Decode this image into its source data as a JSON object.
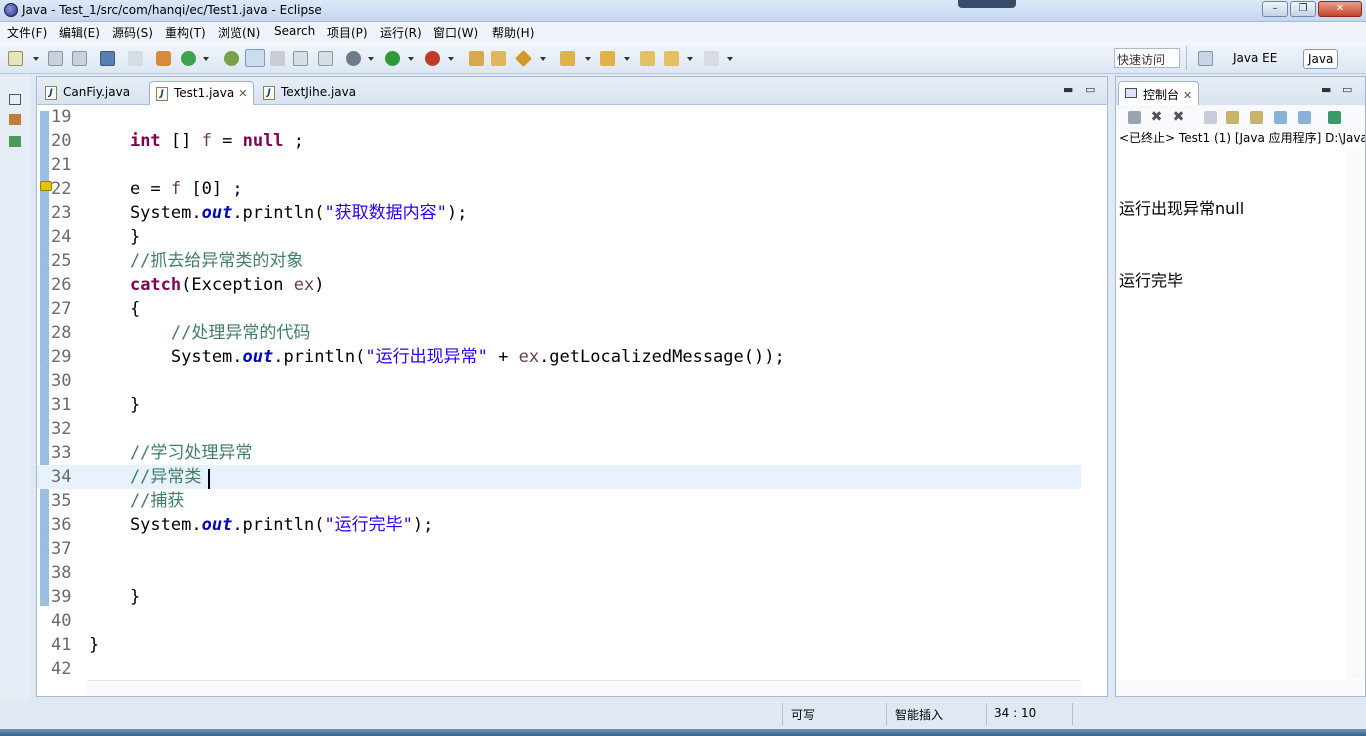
{
  "window": {
    "title": "Java - Test_1/src/com/hanqi/ec/Test1.java - Eclipse",
    "min": "–",
    "max": "❐",
    "close": "✕"
  },
  "menu": [
    "文件(F)",
    "编辑(E)",
    "源码(S)",
    "重构(T)",
    "浏览(N)",
    "Search",
    "项目(P)",
    "运行(R)",
    "窗口(W)",
    "帮助(H)"
  ],
  "toolbar": {
    "quick_access": "快速访问",
    "perspectives": [
      "Java EE",
      "Java"
    ]
  },
  "editor": {
    "tabs": [
      {
        "label": "CanFiy.java",
        "active": false
      },
      {
        "label": "Test1.java",
        "active": true
      },
      {
        "label": "TextJihe.java",
        "active": false
      }
    ],
    "lines": [
      {
        "n": "19",
        "t": []
      },
      {
        "n": "20",
        "t": [
          [
            "",
            "    "
          ],
          [
            "kw",
            "int"
          ],
          [
            "",
            " [] "
          ],
          [
            "var",
            "f"
          ],
          [
            "",
            " = "
          ],
          [
            "kw",
            "null"
          ],
          [
            "",
            " ;"
          ]
        ]
      },
      {
        "n": "21",
        "t": []
      },
      {
        "n": "22",
        "t": [
          [
            "",
            "    e = "
          ],
          [
            "var",
            "f"
          ],
          [
            "",
            " [0] ;"
          ]
        ]
      },
      {
        "n": "23",
        "t": [
          [
            "",
            "    System."
          ],
          [
            "fld",
            "out"
          ],
          [
            "",
            ".println("
          ],
          [
            "str",
            "\"获取数据内容\""
          ],
          [
            "",
            ");"
          ]
        ]
      },
      {
        "n": "24",
        "t": [
          [
            "",
            "    }"
          ]
        ]
      },
      {
        "n": "25",
        "t": [
          [
            "cmt",
            "    //抓去给异常类的对象"
          ]
        ]
      },
      {
        "n": "26",
        "t": [
          [
            "",
            "    "
          ],
          [
            "kw",
            "catch"
          ],
          [
            "",
            "(Exception "
          ],
          [
            "var",
            "ex"
          ],
          [
            "",
            ")"
          ]
        ]
      },
      {
        "n": "27",
        "t": [
          [
            "",
            "    {"
          ]
        ]
      },
      {
        "n": "28",
        "t": [
          [
            "cmt",
            "        //处理异常的代码"
          ]
        ]
      },
      {
        "n": "29",
        "t": [
          [
            "",
            "        System."
          ],
          [
            "fld",
            "out"
          ],
          [
            "",
            ".println("
          ],
          [
            "str",
            "\"运行出现异常\""
          ],
          [
            "",
            " + "
          ],
          [
            "var",
            "ex"
          ],
          [
            "",
            ".getLocalizedMessage());"
          ]
        ]
      },
      {
        "n": "30",
        "t": []
      },
      {
        "n": "31",
        "t": [
          [
            "",
            "    }"
          ]
        ]
      },
      {
        "n": "32",
        "t": []
      },
      {
        "n": "33",
        "t": [
          [
            "cmt",
            "    //学习处理异常"
          ]
        ]
      },
      {
        "n": "34",
        "t": [
          [
            "cmt",
            "    //异常类"
          ]
        ]
      },
      {
        "n": "35",
        "t": [
          [
            "cmt",
            "    //捕获"
          ]
        ]
      },
      {
        "n": "36",
        "t": [
          [
            "",
            "    System."
          ],
          [
            "fld",
            "out"
          ],
          [
            "",
            ".println("
          ],
          [
            "str",
            "\"运行完毕\""
          ],
          [
            "",
            ");"
          ]
        ]
      },
      {
        "n": "37",
        "t": []
      },
      {
        "n": "38",
        "t": []
      },
      {
        "n": "39",
        "t": [
          [
            "",
            "    }"
          ]
        ]
      },
      {
        "n": "40",
        "t": []
      },
      {
        "n": "41",
        "t": [
          [
            "",
            "}"
          ]
        ]
      },
      {
        "n": "42",
        "t": []
      }
    ],
    "current_line": "34"
  },
  "console": {
    "tab_label": "控制台",
    "status": "<已终止> Test1 (1) [Java 应用程序] D:\\Java",
    "output": [
      "运行出现异常null",
      "运行完毕"
    ]
  },
  "statusbar": {
    "writable": "可写",
    "insert_mode": "智能插入",
    "position": "34 : 10"
  },
  "colors": {
    "keyword": "#7f0055",
    "string": "#2a00ff",
    "comment": "#3f7f5f",
    "field": "#0000c0",
    "current_line": "#e8f2fe"
  }
}
